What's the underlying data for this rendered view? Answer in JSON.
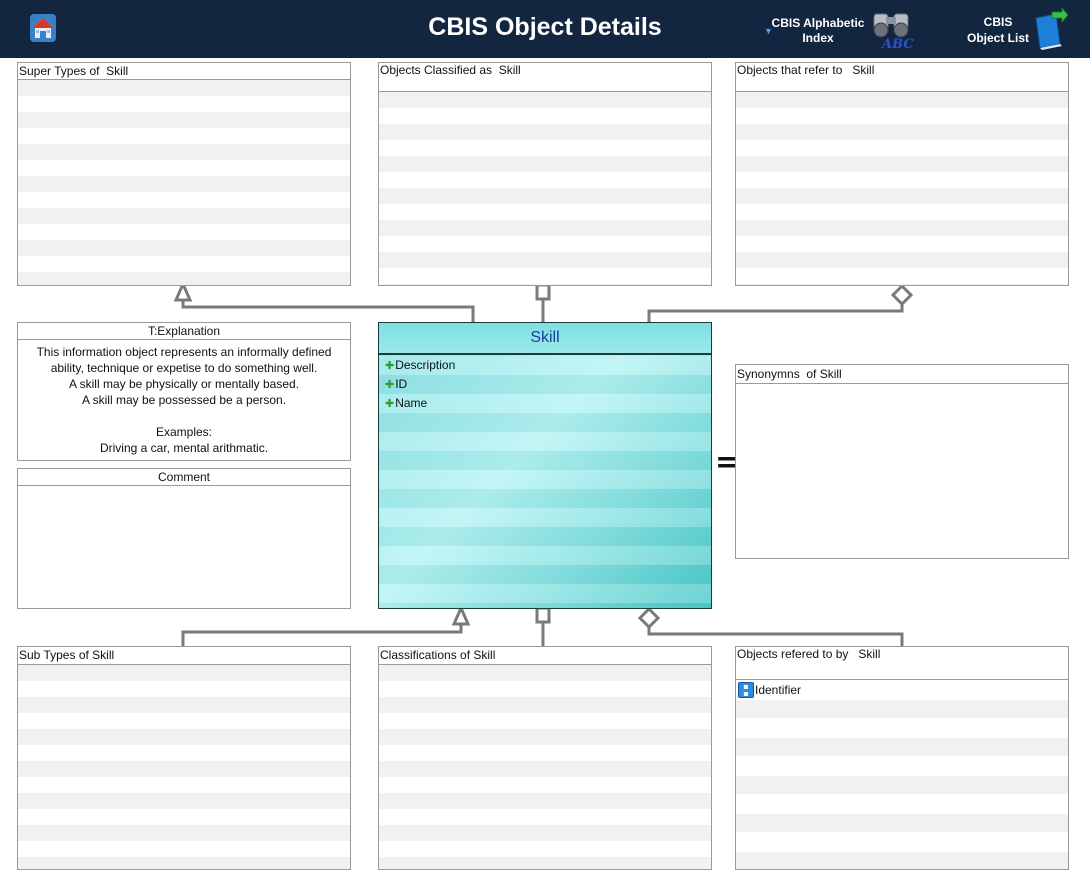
{
  "header": {
    "title": "CBIS Object Details",
    "alphabetic_index": {
      "line1": "CBIS Alphabetic",
      "line2": "Index",
      "icon": "binoculars-abc-icon"
    },
    "object_list": {
      "line1": "CBIS",
      "line2": "Object List",
      "icon": "book-arrow-icon"
    },
    "home_icon": "home-icon",
    "colors": {
      "header_bg": "#132640",
      "text": "#ffffff",
      "accent": "#3fa9f5"
    }
  },
  "panels": {
    "super_types": {
      "title": "Super Types of  Skill"
    },
    "objects_classified": {
      "title": "Objects Classified as  Skill"
    },
    "objects_refer": {
      "title": "Objects that refer to   Skill"
    },
    "explanation": {
      "title": "T:Explanation",
      "text": "This information object represents an informally defined\nability, technique or expetise to do something well.\nA skill may be physically or mentally based.\nA skill may be possessed be a person.\n\nExamples:\nDriving a car, mental arithmatic."
    },
    "comment": {
      "title": "Comment"
    },
    "synonyms": {
      "title": "Synonymns  of Skill"
    },
    "sub_types": {
      "title": "Sub Types of Skill"
    },
    "classifications": {
      "title": "Classifications of Skill"
    },
    "objects_referred_by": {
      "title": "Objects refered to by   Skill",
      "items": [
        "Identifier"
      ]
    }
  },
  "class_box": {
    "name": "Skill",
    "attributes": [
      "Description",
      "ID",
      "Name"
    ],
    "colors": {
      "fill": "#9ae9eb",
      "title_text": "#1e3d9a",
      "attr_marker": "#2e9b2e"
    }
  },
  "connectors": {
    "stroke_color": "#7a7a7a",
    "equals_symbol": "="
  }
}
